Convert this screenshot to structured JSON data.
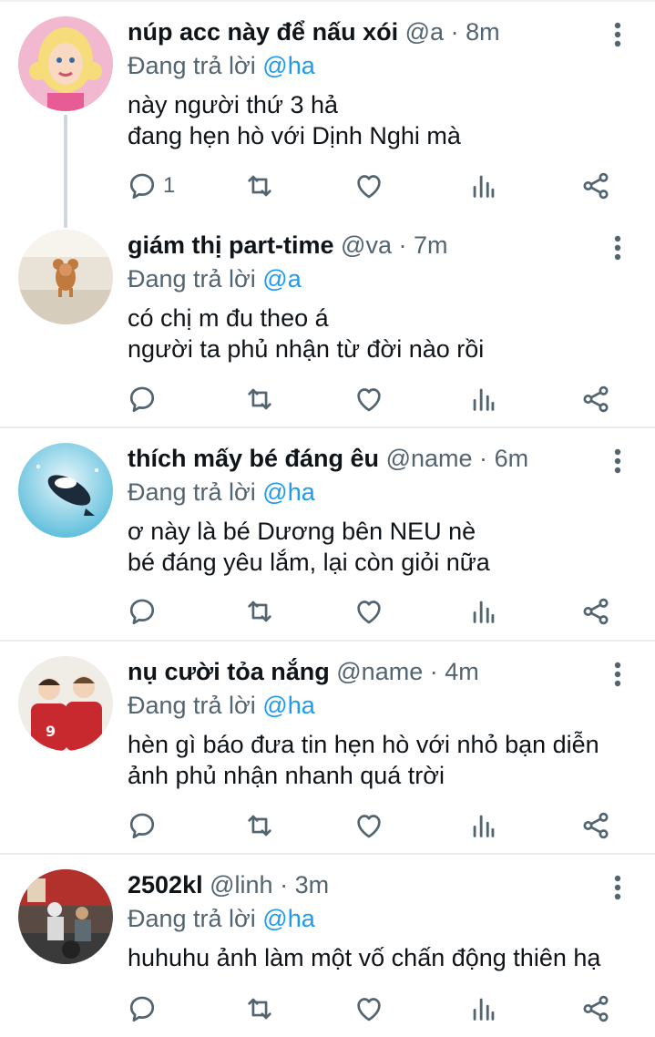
{
  "replies": [
    {
      "name": "núp acc này để nấu xói",
      "handle": "@a",
      "time": "8m",
      "replying_label": "Đang trả lời",
      "replying_to": "@ha",
      "lines": [
        "này người thứ 3 hả",
        "đang hẹn hò với Dịnh Nghi mà"
      ],
      "reply_count": "1",
      "avatar": "doll-avatar"
    },
    {
      "name": "giám thị part-time",
      "handle": "@va",
      "time": "7m",
      "replying_label": "Đang trả lời",
      "replying_to": "@a",
      "lines": [
        "có chị m đu theo á",
        "người ta phủ nhận từ đời nào rồi"
      ],
      "reply_count": "",
      "avatar": "mouse-avatar"
    },
    {
      "name": "thích mấy bé đáng êu",
      "handle": "@name",
      "time": "6m",
      "replying_label": "Đang trả lời",
      "replying_to": "@ha",
      "lines": [
        "ơ này là bé Dương bên NEU nè",
        "bé đáng yêu lắm, lại còn giỏi nữa"
      ],
      "reply_count": "",
      "avatar": "whale-avatar"
    },
    {
      "name": "nụ cười tỏa nắng",
      "handle": "@name",
      "time": "4m",
      "replying_label": "Đang trả lời",
      "replying_to": "@ha",
      "lines": [
        "hèn gì báo đưa tin hẹn hò với nhỏ bạn diễn",
        "ảnh phủ nhận nhanh quá trời"
      ],
      "reply_count": "",
      "avatar": "players-avatar"
    },
    {
      "name": "2502kl",
      "handle": "@linh",
      "time": "3m",
      "replying_label": "Đang trả lời",
      "replying_to": "@ha",
      "lines": [
        "huhuhu ảnh làm một vố chấn động thiên hạ"
      ],
      "reply_count": "",
      "avatar": "street-avatar"
    }
  ],
  "colors": {
    "accent": "#1d9bf0",
    "muted": "#536471",
    "text": "#0f1419"
  },
  "icons": [
    "reply-icon",
    "retweet-icon",
    "like-icon",
    "views-icon",
    "share-icon",
    "more-icon"
  ]
}
